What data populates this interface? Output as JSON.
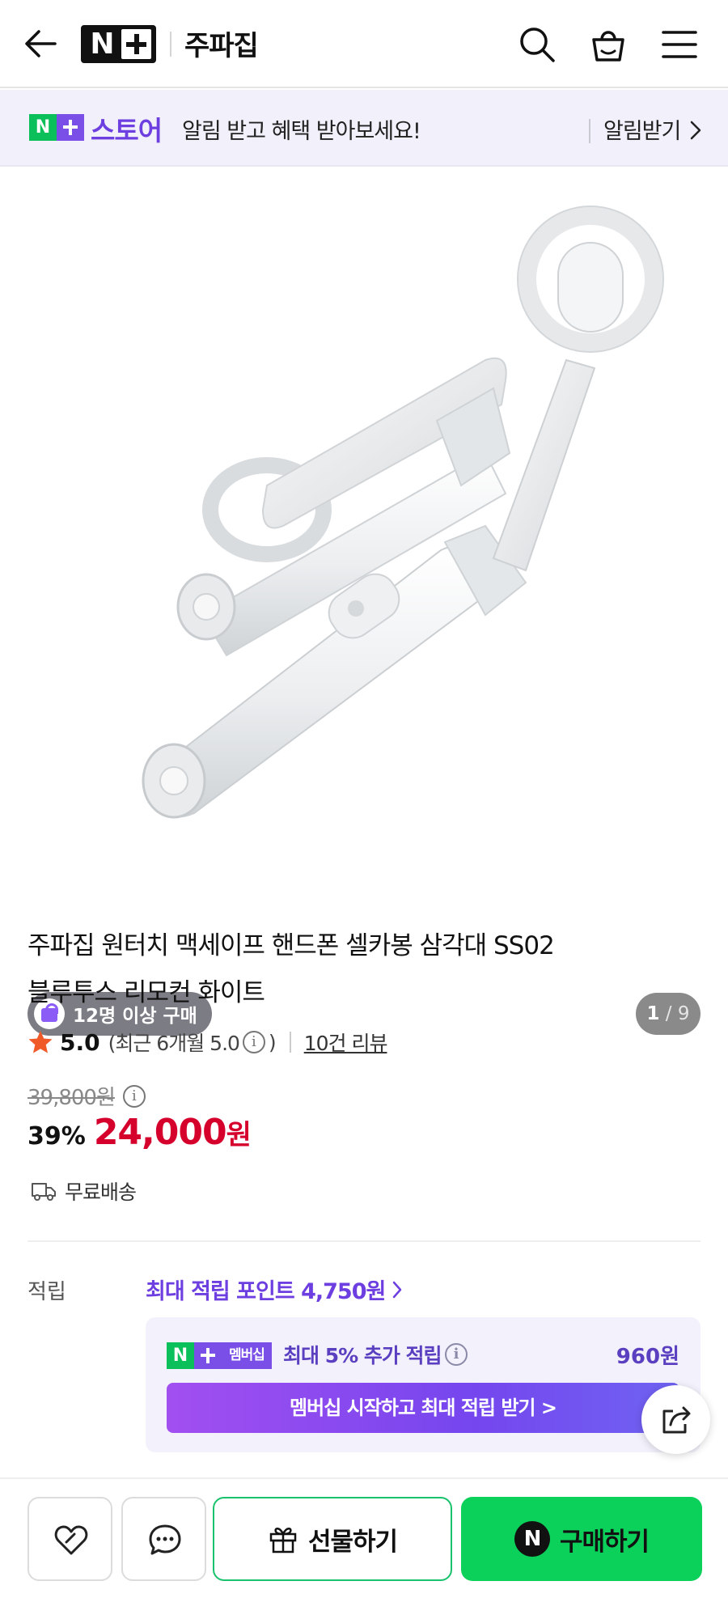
{
  "header": {
    "store_logo": "N+",
    "brand": "주파집",
    "icons": [
      "back-arrow-icon",
      "search-icon",
      "cart-icon",
      "menu-icon"
    ]
  },
  "banner": {
    "store_label": "스토어",
    "message": "알림 받고 혜택 받아보세요!",
    "subscribe_label": "알림받기"
  },
  "gallery": {
    "buyers_badge": "12명 이상 구매",
    "current": "1",
    "total": "9"
  },
  "product": {
    "title_line1": "주파집 원터치 맥세이프 핸드폰 셀카봉 삼각대 SS02",
    "title_line2": "블루투스 리모컨 화이트",
    "rating_score": "5.0",
    "rating_recent": "(최근 6개월 5.0",
    "rating_recent_close": ")",
    "review_link": "10건 리뷰",
    "original_price": "39,800원",
    "discount": "39%",
    "price": "24,000",
    "price_unit": "원",
    "shipping": "무료배송"
  },
  "points": {
    "label": "적립",
    "max_points": "최대 적립 포인트 4,750원",
    "membership_badge": "멤버십",
    "extra_label": "최대 5% 추가 적립",
    "extra_amount": "960원",
    "cta": "멤버십 시작하고 최대 적립 받기 >"
  },
  "bottom_bar": {
    "gift_label": "선물하기",
    "buy_label": "구매하기"
  },
  "colors": {
    "naver_green": "#0bc05a",
    "plus_purple": "#6e3fe0",
    "price_red": "#d6002d",
    "buy_green": "#0bd15a"
  }
}
